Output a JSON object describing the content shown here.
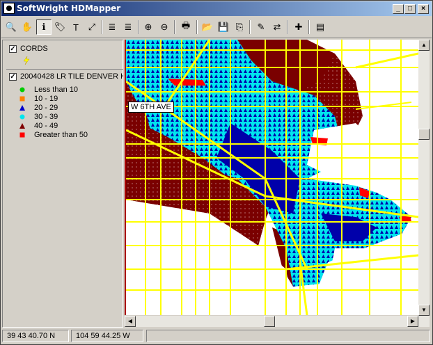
{
  "window": {
    "title": "SoftWright HDMapper"
  },
  "titlebar_buttons": {
    "minimize": "_",
    "maximize": "□",
    "close": "×"
  },
  "toolbar": [
    {
      "name": "zoom-tool-icon",
      "glyph": "🔍",
      "active": false
    },
    {
      "name": "pan-hand-icon",
      "glyph": "✋",
      "active": false
    },
    {
      "name": "info-icon",
      "glyph": "ℹ",
      "active": true
    },
    {
      "name": "label-tool-icon",
      "glyph": "🏷",
      "active": false
    },
    {
      "name": "text-tool-icon",
      "glyph": "T",
      "active": false
    },
    {
      "name": "measure-tool-icon",
      "glyph": "⤢",
      "active": false
    },
    {
      "name": "layers-up-icon",
      "glyph": "≣",
      "active": false
    },
    {
      "name": "layers-down-icon",
      "glyph": "≣",
      "active": false
    },
    {
      "name": "zoom-in-icon",
      "glyph": "⊕",
      "active": false
    },
    {
      "name": "zoom-out-icon",
      "glyph": "⊖",
      "active": false
    },
    {
      "name": "print-icon",
      "glyph": "🖶",
      "active": false
    },
    {
      "name": "open-folder-icon",
      "glyph": "📂",
      "active": false
    },
    {
      "name": "save-icon",
      "glyph": "💾",
      "active": false
    },
    {
      "name": "export-icon",
      "glyph": "⎘",
      "active": false
    },
    {
      "name": "properties-icon",
      "glyph": "✎",
      "active": false
    },
    {
      "name": "exchange-icon",
      "glyph": "⇄",
      "active": false
    },
    {
      "name": "add-layer-icon",
      "glyph": "✚",
      "active": false
    },
    {
      "name": "overview-icon",
      "glyph": "▤",
      "active": false
    }
  ],
  "legend": {
    "layers": [
      {
        "checked": "✓",
        "name": "CORDS"
      },
      {
        "checked": "✓",
        "name": "20040428 LR TILE DENVER H"
      }
    ],
    "items": [
      {
        "label": "Less than 10",
        "color": "#00cc00",
        "shape": "circle"
      },
      {
        "label": "10 - 19",
        "color": "#ff8000",
        "shape": "square"
      },
      {
        "label": "20 - 29",
        "color": "#0000cc",
        "shape": "triangle"
      },
      {
        "label": "30 - 39",
        "color": "#00e5ee",
        "shape": "circle"
      },
      {
        "label": "40 - 49",
        "color": "#800000",
        "shape": "triangle"
      },
      {
        "label": "Greater than 50",
        "color": "#ff0000",
        "shape": "square"
      }
    ]
  },
  "map": {
    "callout": "W 6TH AVE",
    "colors": {
      "road": "#ffff00",
      "dark_red": "#7a0000",
      "cyan": "#00e5ee",
      "blue": "#0000aa",
      "red": "#ff0000",
      "land": "#ffffff"
    }
  },
  "status": {
    "latitude": "39 43 40.70 N",
    "longitude": "104 59 44.25 W"
  },
  "scroll": {
    "up": "▲",
    "down": "▼",
    "left": "◀",
    "right": "▶"
  }
}
